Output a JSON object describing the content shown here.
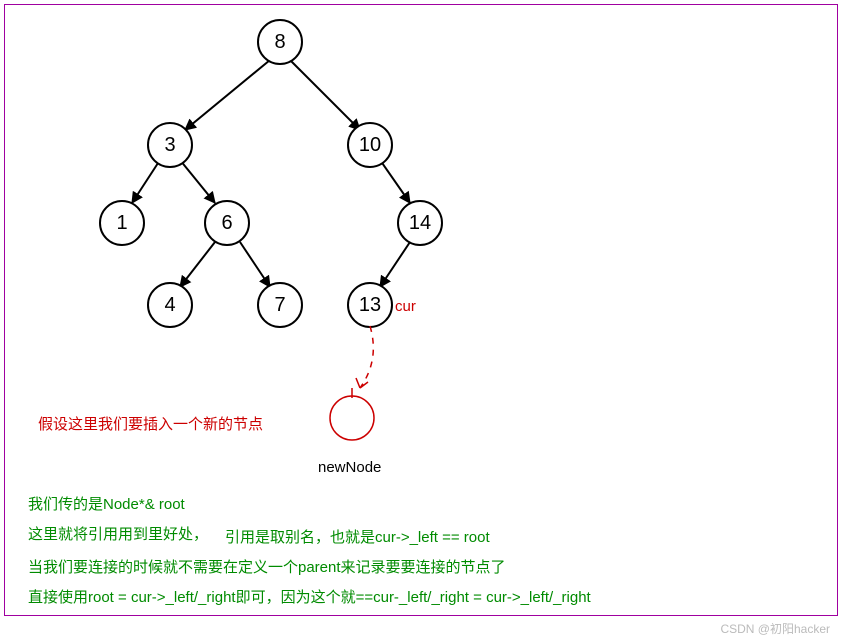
{
  "tree": {
    "n0": "8",
    "n1": "3",
    "n2": "10",
    "n3": "1",
    "n4": "6",
    "n5": "14",
    "n6": "4",
    "n7": "7",
    "n8": "13"
  },
  "labels": {
    "cur": "cur",
    "insert_note": "假设这里我们要插入一个新的节点",
    "newNode": "newNode"
  },
  "explain": {
    "l1": "我们传的是Node*& root",
    "l2a": "这里就将引用用到里好处，",
    "l2b": "引用是取别名，也就是cur->_left == root",
    "l3": "当我们要连接的时候就不需要在定义一个parent来记录要要连接的节点了",
    "l4": "直接使用root = cur->_left/_right即可，因为这个就==cur-_left/_right = cur->_left/_right"
  },
  "watermark": "CSDN @初阳hacker"
}
